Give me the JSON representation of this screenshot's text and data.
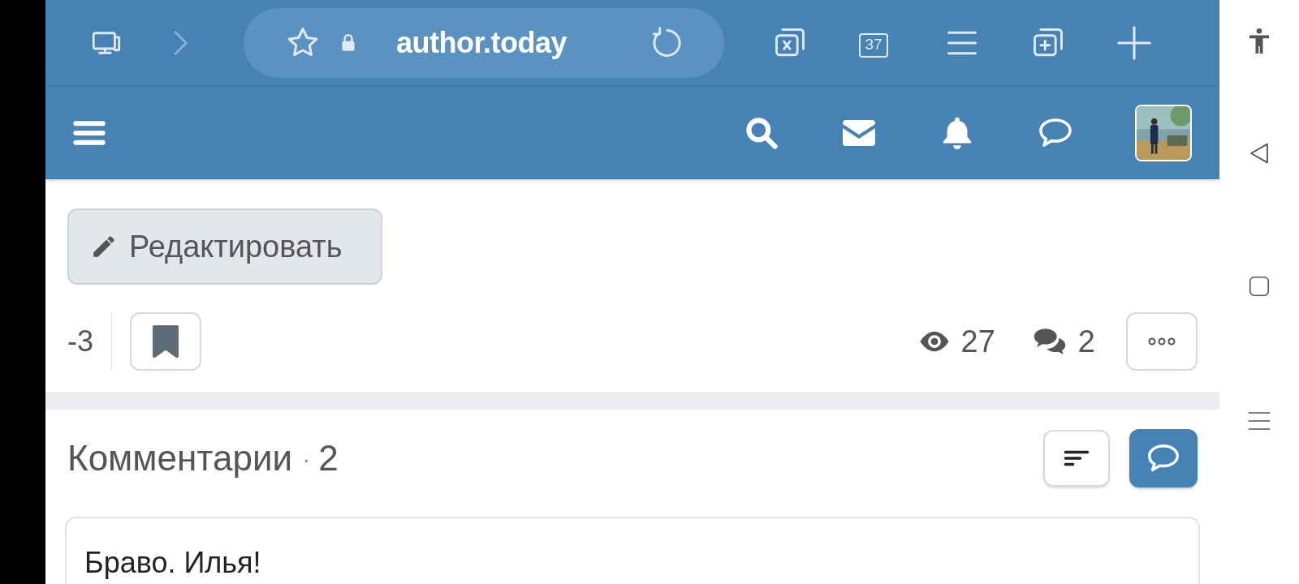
{
  "browser_bar": {
    "url": "author.today",
    "tab_count": "37"
  },
  "post_actions": {
    "edit_button": "Редактировать",
    "rating": "-3",
    "bookmarked": true,
    "views": "27",
    "comments": "2"
  },
  "comments": {
    "title": "Комментарии",
    "separator": "·",
    "count": "2",
    "items": [
      {
        "text": "Браво. Илья!"
      }
    ]
  }
}
